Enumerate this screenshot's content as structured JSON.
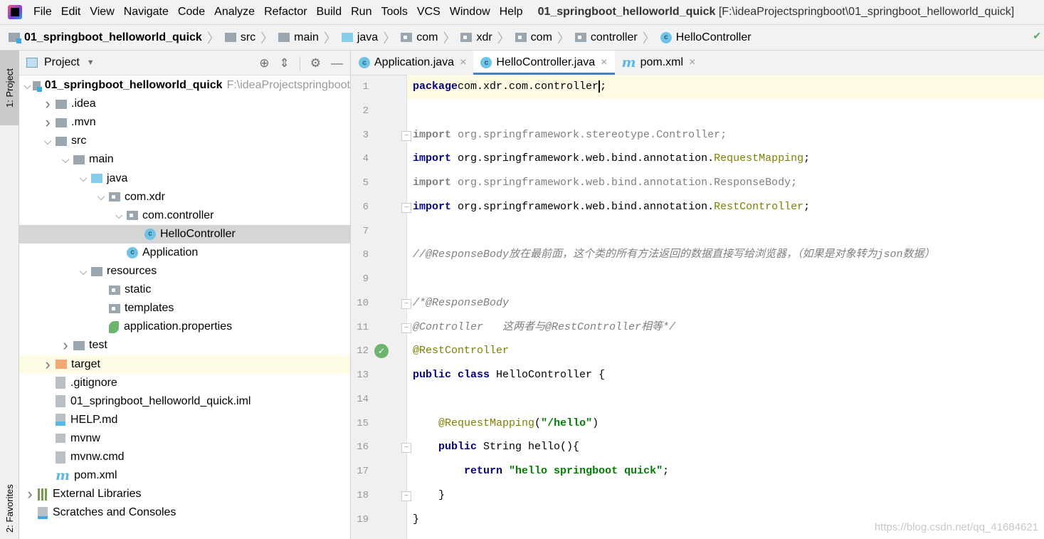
{
  "menu": [
    "File",
    "Edit",
    "View",
    "Navigate",
    "Code",
    "Analyze",
    "Refactor",
    "Build",
    "Run",
    "Tools",
    "VCS",
    "Window",
    "Help"
  ],
  "window_title": {
    "project": "01_springboot_helloworld_quick",
    "path": "[F:\\ideaProjectspringboot\\01_springboot_helloworld_quick]"
  },
  "breadcrumb": [
    {
      "label": "01_springboot_helloworld_quick",
      "icon": "module-folder-icon"
    },
    {
      "label": "src",
      "icon": "folder-icon"
    },
    {
      "label": "main",
      "icon": "folder-icon"
    },
    {
      "label": "java",
      "icon": "source-folder-icon"
    },
    {
      "label": "com",
      "icon": "package-icon"
    },
    {
      "label": "xdr",
      "icon": "package-icon"
    },
    {
      "label": "com",
      "icon": "package-icon"
    },
    {
      "label": "controller",
      "icon": "package-icon"
    },
    {
      "label": "HelloController",
      "icon": "class-icon"
    }
  ],
  "left_stripe": {
    "project": "1: Project",
    "favorites": "2: Favorites"
  },
  "project_panel": {
    "title": "Project"
  },
  "tree": [
    {
      "label": "01_springboot_helloworld_quick",
      "extra": "F:\\ideaProjectspringboot",
      "level": 0,
      "chev": "down",
      "icon": "module",
      "bold": true
    },
    {
      "label": ".idea",
      "level": 1,
      "chev": "right",
      "icon": "folder"
    },
    {
      "label": ".mvn",
      "level": 1,
      "chev": "right",
      "icon": "folder"
    },
    {
      "label": "src",
      "level": 1,
      "chev": "down",
      "icon": "folder"
    },
    {
      "label": "main",
      "level": 2,
      "chev": "down",
      "icon": "folder"
    },
    {
      "label": "java",
      "level": 3,
      "chev": "down",
      "icon": "source"
    },
    {
      "label": "com.xdr",
      "level": 4,
      "chev": "down",
      "icon": "package"
    },
    {
      "label": "com.controller",
      "level": 5,
      "chev": "down",
      "icon": "package"
    },
    {
      "label": "HelloController",
      "level": 6,
      "icon": "class",
      "selected": true
    },
    {
      "label": "Application",
      "level": 5,
      "icon": "class"
    },
    {
      "label": "resources",
      "level": 3,
      "chev": "down",
      "icon": "resources"
    },
    {
      "label": "static",
      "level": 4,
      "icon": "package"
    },
    {
      "label": "templates",
      "level": 4,
      "icon": "package"
    },
    {
      "label": "application.properties",
      "level": 4,
      "icon": "spring"
    },
    {
      "label": "test",
      "level": 2,
      "chev": "right",
      "icon": "folder"
    },
    {
      "label": "target",
      "level": 1,
      "chev": "right",
      "icon": "excluded",
      "highlight": true
    },
    {
      "label": ".gitignore",
      "level": 1,
      "icon": "file"
    },
    {
      "label": "01_springboot_helloworld_quick.iml",
      "level": 1,
      "icon": "file"
    },
    {
      "label": "HELP.md",
      "level": 1,
      "icon": "markdown"
    },
    {
      "label": "mvnw",
      "level": 1,
      "icon": "script"
    },
    {
      "label": "mvnw.cmd",
      "level": 1,
      "icon": "file"
    },
    {
      "label": "pom.xml",
      "level": 1,
      "icon": "maven"
    },
    {
      "label": "External Libraries",
      "level": 0,
      "chev": "right",
      "icon": "libraries"
    },
    {
      "label": "Scratches and Consoles",
      "level": 0,
      "icon": "scratches"
    }
  ],
  "tabs": [
    {
      "label": "Application.java",
      "icon": "class-icon",
      "active": false
    },
    {
      "label": "HelloController.java",
      "icon": "class-icon",
      "active": true
    },
    {
      "label": "pom.xml",
      "icon": "maven-icon",
      "active": false
    }
  ],
  "code": [
    [
      [
        "kw",
        "package"
      ],
      [
        "",
        "com.xdr.com.controller"
      ],
      [
        "caret",
        ";"
      ]
    ],
    [],
    [
      [
        "kwg",
        "import"
      ],
      [
        "gray",
        " org.springframework.stereotype.Controller;"
      ]
    ],
    [
      [
        "kw",
        "import"
      ],
      [
        "",
        " org.springframework.web.bind.annotation."
      ],
      [
        "ann",
        "RequestMapping"
      ],
      [
        "",
        ";"
      ]
    ],
    [
      [
        "kwg",
        "import"
      ],
      [
        "gray",
        " org.springframework.web.bind.annotation.ResponseBody;"
      ]
    ],
    [
      [
        "kw",
        "import"
      ],
      [
        "",
        " org.springframework.web.bind.annotation."
      ],
      [
        "ann",
        "RestController"
      ],
      [
        "",
        ";"
      ]
    ],
    [],
    [
      [
        "cmt",
        "//@ResponseBody放在最前面，这个类的所有方法返回的数据直接写给浏览器，（如果是对象转为json数据）"
      ]
    ],
    [],
    [
      [
        "cmt",
        "/*@ResponseBody"
      ]
    ],
    [
      [
        "cmt",
        "@Controller   这两者与@RestController相等*/"
      ]
    ],
    [
      [
        "ann",
        "@RestController"
      ]
    ],
    [
      [
        "kw",
        "public class"
      ],
      [
        "",
        " HelloController {"
      ]
    ],
    [],
    [
      [
        "",
        "    "
      ],
      [
        "ann",
        "@RequestMapping"
      ],
      [
        "",
        "("
      ],
      [
        "str",
        "\"/hello\""
      ],
      [
        "",
        ")"
      ]
    ],
    [
      [
        "",
        "    "
      ],
      [
        "kw",
        "public"
      ],
      [
        "",
        " String hello(){"
      ]
    ],
    [
      [
        "",
        "        "
      ],
      [
        "kw",
        "return"
      ],
      [
        "",
        " "
      ],
      [
        "str",
        "\"hello springboot quick\""
      ],
      [
        "",
        ";"
      ]
    ],
    [
      [
        "",
        "    }"
      ]
    ],
    [
      [
        "",
        "}"
      ]
    ]
  ],
  "watermark": "https://blog.csdn.net/qq_41684621"
}
